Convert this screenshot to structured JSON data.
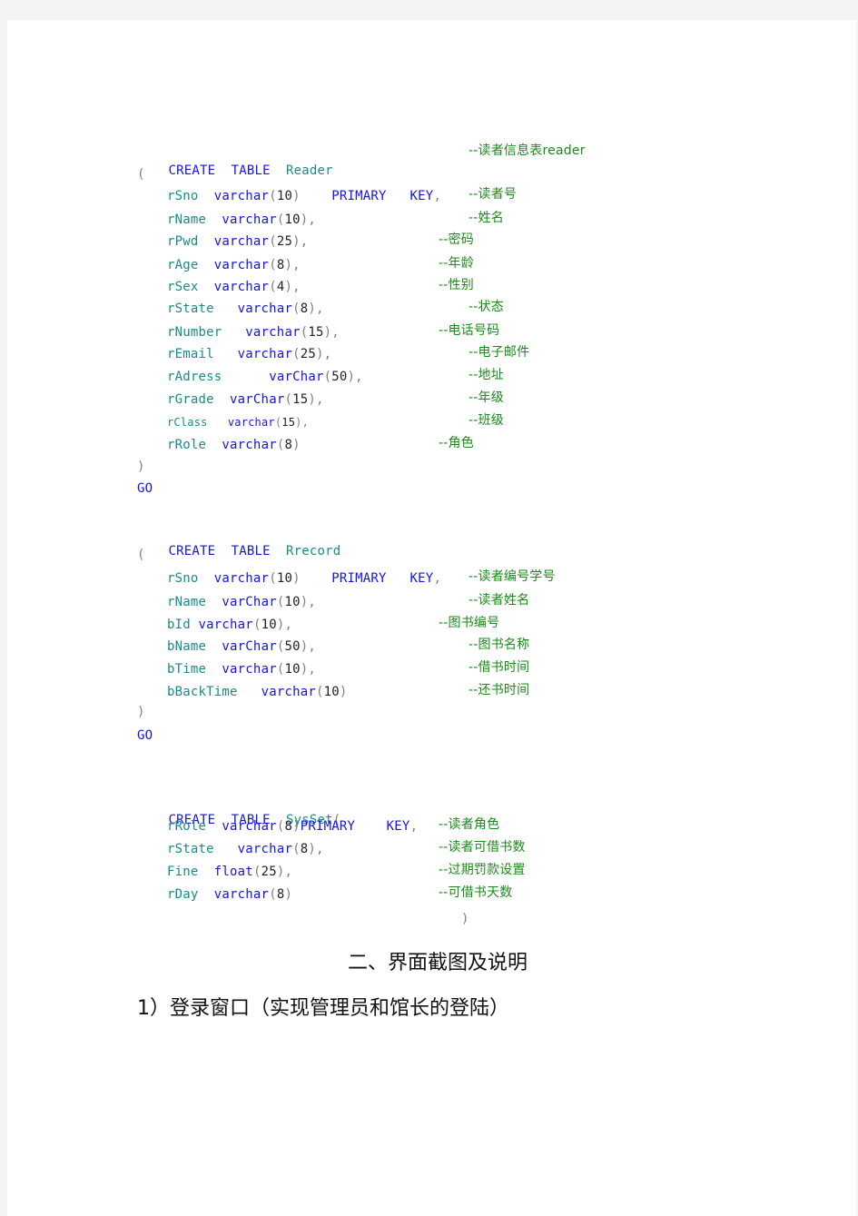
{
  "document": {
    "tables": [
      {
        "name": "Reader",
        "header": {
          "create": "CREATE",
          "table": "TABLE",
          "name": "Reader",
          "comment": "--读者信息表reader"
        },
        "open": "(",
        "close": ")",
        "go": "GO",
        "columns": [
          {
            "name": "rSno",
            "type": "varchar",
            "size": "10",
            "constraint": "PRIMARY   KEY",
            "suffix": ",",
            "comment": "--读者号"
          },
          {
            "name": "rName",
            "type": "varchar",
            "size": "10",
            "constraint": "",
            "suffix": ",",
            "comment": "--姓名"
          },
          {
            "name": "rPwd",
            "type": "varchar",
            "size": "25",
            "constraint": "",
            "suffix": ",",
            "comment": "--密码"
          },
          {
            "name": "rAge",
            "type": "varchar",
            "size": "8",
            "constraint": "",
            "suffix": ",",
            "comment": "--年龄"
          },
          {
            "name": "rSex",
            "type": "varchar",
            "size": "4",
            "constraint": "",
            "suffix": ",",
            "comment": "--性别"
          },
          {
            "name": "rState",
            "type": "varchar",
            "size": "8",
            "constraint": "",
            "suffix": ",",
            "comment": "--状态"
          },
          {
            "name": "rNumber",
            "type": "varchar",
            "size": "15",
            "constraint": "",
            "suffix": ",",
            "comment": "--电话号码"
          },
          {
            "name": "rEmail",
            "type": "varchar",
            "size": "25",
            "constraint": "",
            "suffix": ",",
            "comment": "--电子邮件"
          },
          {
            "name": "rAdress",
            "type": "varChar",
            "size": "50",
            "constraint": "",
            "suffix": ",",
            "comment": "--地址"
          },
          {
            "name": "rGrade",
            "type": "varChar",
            "size": "15",
            "constraint": "",
            "suffix": ",",
            "comment": "--年级"
          },
          {
            "name": "rClass",
            "type": "varchar",
            "size": "15",
            "constraint": "",
            "suffix": ",",
            "comment": "--班级"
          },
          {
            "name": "rRole",
            "type": "varchar",
            "size": "8",
            "constraint": "",
            "suffix": "",
            "comment": "--角色"
          }
        ]
      },
      {
        "name": "Rrecord",
        "header": {
          "create": "CREATE",
          "table": "TABLE",
          "name": "Rrecord",
          "comment": ""
        },
        "open": "(",
        "close": ")",
        "go": "GO",
        "columns": [
          {
            "name": "rSno",
            "type": "varchar",
            "size": "10",
            "constraint": "PRIMARY   KEY",
            "suffix": ",",
            "comment": "--读者编号学号"
          },
          {
            "name": "rName",
            "type": "varChar",
            "size": "10",
            "constraint": "",
            "suffix": ",",
            "comment": "--读者姓名"
          },
          {
            "name": "bId",
            "type": "varchar",
            "size": "10",
            "constraint": "",
            "suffix": ",",
            "comment": "--图书编号"
          },
          {
            "name": "bName",
            "type": "varChar",
            "size": "50",
            "constraint": "",
            "suffix": ",",
            "comment": "--图书名称"
          },
          {
            "name": "bTime",
            "type": "varchar",
            "size": "10",
            "constraint": "",
            "suffix": ",",
            "comment": "--借书时间"
          },
          {
            "name": "bBackTime",
            "type": "varchar",
            "size": "10",
            "constraint": "",
            "suffix": "",
            "comment": "--还书时间"
          }
        ]
      },
      {
        "name": "SysSet",
        "header": {
          "create": "CREATE",
          "table": "TABLE",
          "name": "SysSet",
          "open": "(",
          "comment": ""
        },
        "close": ")",
        "columns": [
          {
            "name": "rRole",
            "type": "varchar",
            "size": "8",
            "constraint": "PRIMARY    KEY",
            "suffix": ",",
            "comment": "--读者角色"
          },
          {
            "name": "rState",
            "type": "varchar",
            "size": "8",
            "constraint": "",
            "suffix": ",",
            "comment": "--读者可借书数"
          },
          {
            "name": "Fine",
            "type": "float",
            "size": "25",
            "constraint": "",
            "suffix": ",",
            "comment": "--过期罚款设置"
          },
          {
            "name": "rDay",
            "type": "varchar",
            "size": "8",
            "constraint": "",
            "suffix": "",
            "comment": "--可借书天数"
          }
        ]
      }
    ],
    "section_heading": "二、界面截图及说明",
    "subsection_heading": "1）登录窗口（实现管理员和馆长的登陆）"
  },
  "colors": {
    "keyword": "#1414e6",
    "identifier": "#1a8a8a",
    "comment": "#1a8a1a",
    "number": "#222222",
    "page_background": "#f3f3f3"
  }
}
